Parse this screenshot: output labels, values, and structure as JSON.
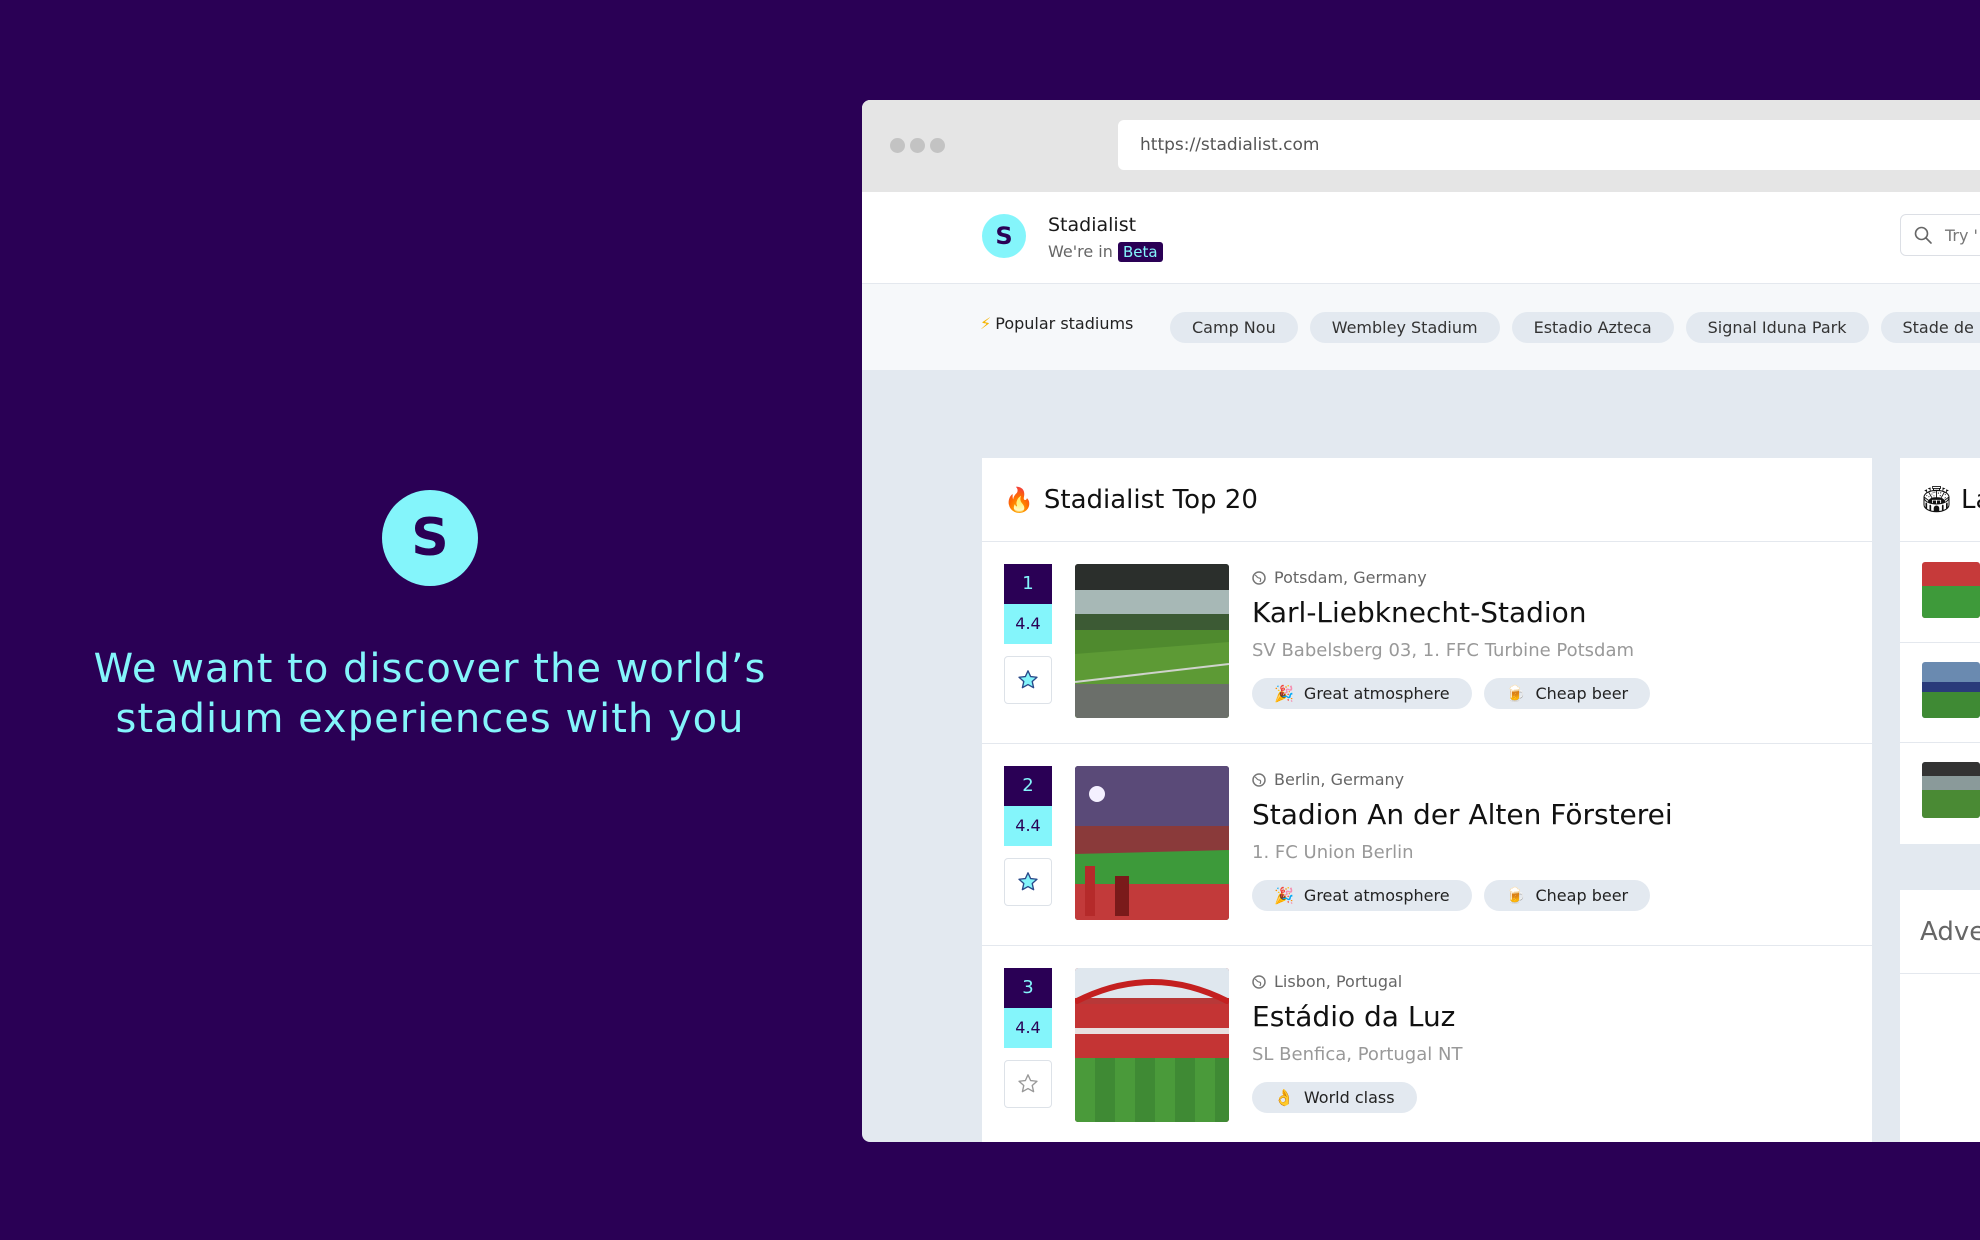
{
  "hero": {
    "logo_letter": "S",
    "tagline_line1": "We want to discover the world’s",
    "tagline_line2": "stadium experiences with you"
  },
  "browser": {
    "url": "https://stadialist.com"
  },
  "app": {
    "logo_letter": "S",
    "name": "Stadialist",
    "subtitle_prefix": "We're in",
    "badge": "Beta",
    "search_placeholder": "Try '"
  },
  "popular": {
    "label": "Popular stadiums",
    "chips": [
      "Camp Nou",
      "Wembley Stadium",
      "Estadio Azteca",
      "Signal Iduna Park",
      "Stade de"
    ]
  },
  "top20": {
    "title": "Stadialist Top 20",
    "rows": [
      {
        "rank": "1",
        "rating": "4.4",
        "location": "Potsdam, Germany",
        "name": "Karl-Liebknecht-Stadion",
        "clubs": "SV Babelsberg 03, 1. FFC Turbine Potsdam",
        "tags": [
          {
            "emoji": "🎉",
            "label": "Great atmosphere"
          },
          {
            "emoji": "🍺",
            "label": "Cheap beer"
          }
        ],
        "favorited": true
      },
      {
        "rank": "2",
        "rating": "4.4",
        "location": "Berlin, Germany",
        "name": "Stadion An der Alten Försterei",
        "clubs": "1. FC Union Berlin",
        "tags": [
          {
            "emoji": "🎉",
            "label": "Great atmosphere"
          },
          {
            "emoji": "🍺",
            "label": "Cheap beer"
          }
        ],
        "favorited": true
      },
      {
        "rank": "3",
        "rating": "4.4",
        "location": "Lisbon, Portugal",
        "name": "Estádio da Luz",
        "clubs": "SL Benfica, Portugal NT",
        "tags": [
          {
            "emoji": "👌",
            "label": "World class"
          }
        ],
        "favorited": false
      }
    ]
  },
  "side_card": {
    "title_partial": "La"
  },
  "ad_card": {
    "title_partial": "Adve"
  },
  "colors": {
    "background": "#2a0055",
    "accent": "#84f5fb",
    "page_bg": "#e3e9f0"
  }
}
